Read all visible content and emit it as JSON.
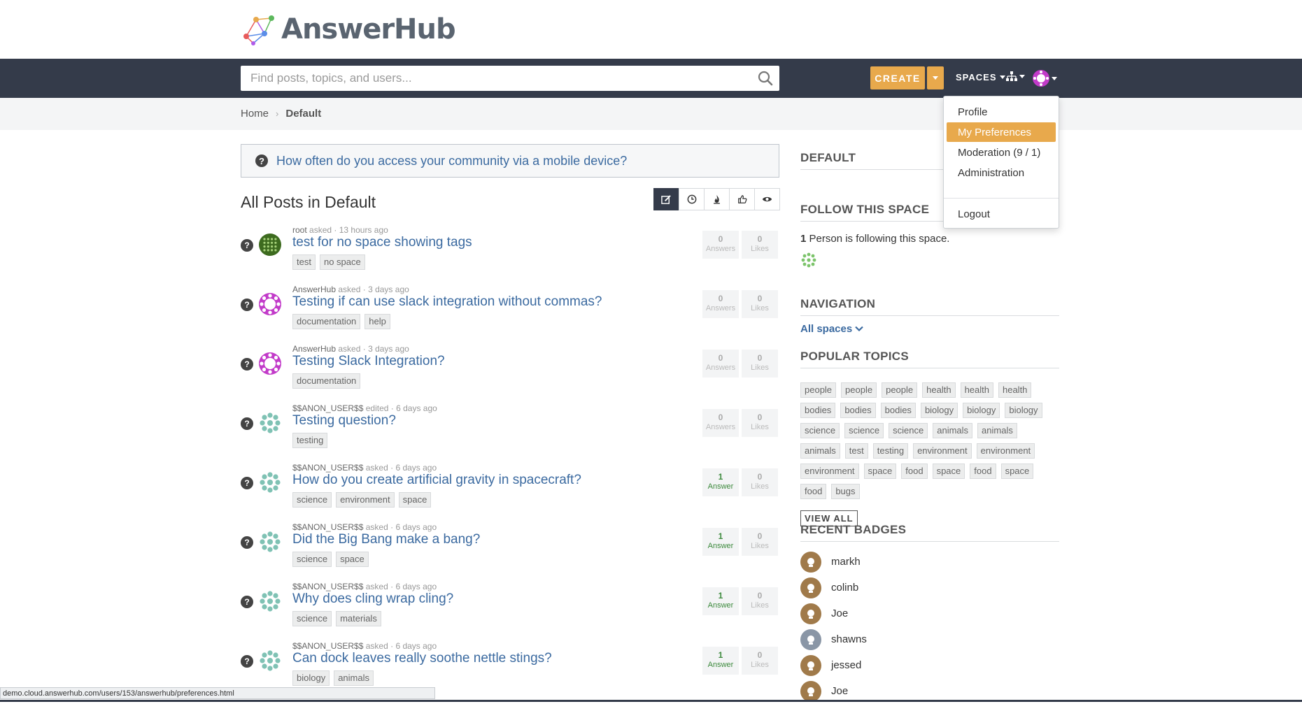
{
  "brand": {
    "name": "AnswerHub"
  },
  "nav": {
    "search_placeholder": "Find posts, topics, and users...",
    "create_label": "CREATE",
    "spaces_label": "SPACES"
  },
  "breadcrumb": {
    "home": "Home",
    "current": "Default"
  },
  "poll": {
    "question": "How often do you access your community via a mobile device?"
  },
  "posts": {
    "heading": "All Posts in Default",
    "items": [
      {
        "author": "root",
        "action": "asked",
        "time": "13 hours ago",
        "title": "test for no space showing tags",
        "tags": [
          "test",
          "no space"
        ],
        "answers": "0",
        "answers_label": "Answers",
        "likes": "0",
        "likes_label": "Likes",
        "avatar_color": "#3d6b1f"
      },
      {
        "author": "AnswerHub",
        "action": "asked",
        "time": "3 days ago",
        "title": "Testing if can use slack integration without commas?",
        "tags": [
          "documentation",
          "help"
        ],
        "answers": "0",
        "answers_label": "Answers",
        "likes": "0",
        "likes_label": "Likes",
        "avatar_color": "#c23bc9"
      },
      {
        "author": "AnswerHub",
        "action": "asked",
        "time": "3 days ago",
        "title": "Testing Slack Integration?",
        "tags": [
          "documentation"
        ],
        "answers": "0",
        "answers_label": "Answers",
        "likes": "0",
        "likes_label": "Likes",
        "avatar_color": "#c23bc9"
      },
      {
        "author": "$$ANON_USER$$",
        "action": "edited",
        "time": "6 days ago",
        "title": "Testing question?",
        "tags": [
          "testing"
        ],
        "answers": "0",
        "answers_label": "Answers",
        "likes": "0",
        "likes_label": "Likes",
        "avatar_color": "#7fc2b4"
      },
      {
        "author": "$$ANON_USER$$",
        "action": "asked",
        "time": "6 days ago",
        "title": "How do you create artificial gravity in spacecraft?",
        "tags": [
          "science",
          "environment",
          "space"
        ],
        "answers": "1",
        "answers_label": "Answer",
        "likes": "0",
        "likes_label": "Likes",
        "avatar_color": "#7fc2b4"
      },
      {
        "author": "$$ANON_USER$$",
        "action": "asked",
        "time": "6 days ago",
        "title": "Did the Big Bang make a bang?",
        "tags": [
          "science",
          "space"
        ],
        "answers": "1",
        "answers_label": "Answer",
        "likes": "0",
        "likes_label": "Likes",
        "avatar_color": "#7fc2b4"
      },
      {
        "author": "$$ANON_USER$$",
        "action": "asked",
        "time": "6 days ago",
        "title": "Why does cling wrap cling?",
        "tags": [
          "science",
          "materials"
        ],
        "answers": "1",
        "answers_label": "Answer",
        "likes": "0",
        "likes_label": "Likes",
        "avatar_color": "#7fc2b4"
      },
      {
        "author": "$$ANON_USER$$",
        "action": "asked",
        "time": "6 days ago",
        "title": "Can dock leaves really soothe nettle stings?",
        "tags": [
          "biology",
          "animals"
        ],
        "answers": "1",
        "answers_label": "Answer",
        "likes": "0",
        "likes_label": "Likes",
        "avatar_color": "#7fc2b4"
      }
    ]
  },
  "sidebar": {
    "space_heading": "DEFAULT",
    "follow_heading": "FOLLOW THIS SPACE",
    "follow_count": "1",
    "follow_text": "Person is following this space.",
    "navigation_heading": "NAVIGATION",
    "all_spaces": "All spaces",
    "topics_heading": "POPULAR TOPICS",
    "topics": [
      "people",
      "people",
      "people",
      "health",
      "health",
      "health",
      "bodies",
      "bodies",
      "bodies",
      "biology",
      "biology",
      "biology",
      "science",
      "science",
      "science",
      "animals",
      "animals",
      "animals",
      "test",
      "testing",
      "environment",
      "environment",
      "environment",
      "space",
      "food",
      "space",
      "food",
      "space",
      "food",
      "bugs"
    ],
    "view_all": "VIEW ALL",
    "badges_heading": "RECENT BADGES",
    "badges": [
      {
        "name": "markh",
        "icon": "lightbulb-icon",
        "color": "#a07a4a"
      },
      {
        "name": "colinb",
        "icon": "thumbs-icon",
        "color": "#a07a4a"
      },
      {
        "name": "Joe",
        "icon": "graduation-cap-icon",
        "color": "#a07a4a"
      },
      {
        "name": "shawns",
        "icon": "medal-icon",
        "color": "#8a96a6"
      },
      {
        "name": "jessed",
        "icon": "person-icon",
        "color": "#a07a4a"
      },
      {
        "name": "Joe",
        "icon": "badge-icon",
        "color": "#a07a4a"
      }
    ]
  },
  "user_menu": {
    "items": [
      {
        "label": "Profile"
      },
      {
        "label": "My Preferences"
      },
      {
        "label": "Moderation (9 / 1)"
      },
      {
        "label": "Administration"
      },
      {
        "label": "Logout"
      }
    ]
  },
  "status_bar": {
    "url": "demo.cloud.answerhub.com/users/153/answerhub/preferences.html"
  },
  "colors": {
    "accent": "#e8a94c",
    "navbar": "#343b4a",
    "link": "#3b6aa0"
  }
}
